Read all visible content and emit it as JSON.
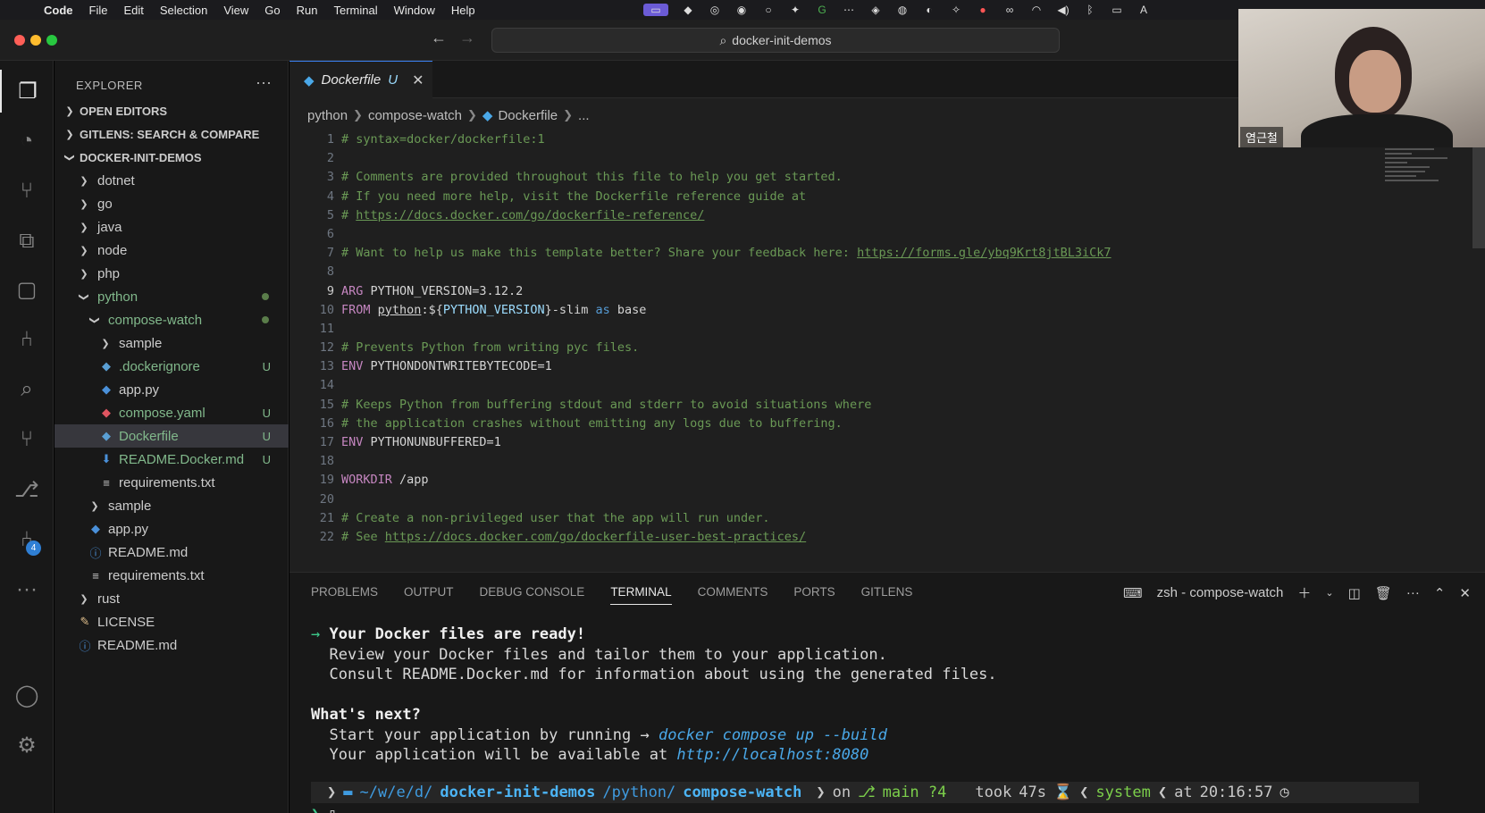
{
  "menubar": {
    "apple": "",
    "items": [
      "Code",
      "File",
      "Edit",
      "Selection",
      "View",
      "Go",
      "Run",
      "Terminal",
      "Window",
      "Help"
    ]
  },
  "titlebar": {
    "search": "docker-init-demos"
  },
  "sidebar": {
    "title": "EXPLORER",
    "more": "···",
    "sections": [
      "OPEN EDITORS",
      "GITLENS: SEARCH & COMPARE",
      "DOCKER-INIT-DEMOS"
    ],
    "tree": [
      {
        "label": "dotnet",
        "depth": 1,
        "kind": "folder",
        "open": false,
        "status": ""
      },
      {
        "label": "go",
        "depth": 1,
        "kind": "folder",
        "open": false,
        "status": ""
      },
      {
        "label": "java",
        "depth": 1,
        "kind": "folder",
        "open": false,
        "status": ""
      },
      {
        "label": "node",
        "depth": 1,
        "kind": "folder",
        "open": false,
        "status": ""
      },
      {
        "label": "php",
        "depth": 1,
        "kind": "folder",
        "open": false,
        "status": ""
      },
      {
        "label": "python",
        "depth": 1,
        "kind": "folder",
        "open": true,
        "status": "dot"
      },
      {
        "label": "compose-watch",
        "depth": 2,
        "kind": "folder",
        "open": true,
        "status": "dot"
      },
      {
        "label": "sample",
        "depth": 3,
        "kind": "folder",
        "open": false,
        "status": ""
      },
      {
        "label": ".dockerignore",
        "depth": 3,
        "kind": "docker",
        "status": "U"
      },
      {
        "label": "app.py",
        "depth": 3,
        "kind": "py",
        "status": ""
      },
      {
        "label": "compose.yaml",
        "depth": 3,
        "kind": "yaml",
        "status": "U"
      },
      {
        "label": "Dockerfile",
        "depth": 3,
        "kind": "docker",
        "status": "U",
        "selected": true
      },
      {
        "label": "README.Docker.md",
        "depth": 3,
        "kind": "md",
        "status": "U"
      },
      {
        "label": "requirements.txt",
        "depth": 3,
        "kind": "txt",
        "status": ""
      },
      {
        "label": "sample",
        "depth": 2,
        "kind": "folder",
        "open": false,
        "status": ""
      },
      {
        "label": "app.py",
        "depth": 2,
        "kind": "py",
        "status": ""
      },
      {
        "label": "README.md",
        "depth": 2,
        "kind": "info",
        "status": ""
      },
      {
        "label": "requirements.txt",
        "depth": 2,
        "kind": "txt",
        "status": ""
      },
      {
        "label": "rust",
        "depth": 1,
        "kind": "folder",
        "open": false,
        "status": ""
      },
      {
        "label": "LICENSE",
        "depth": 1,
        "kind": "license",
        "status": ""
      },
      {
        "label": "README.md",
        "depth": 1,
        "kind": "info",
        "status": ""
      }
    ]
  },
  "activity": {
    "source_control_badge": "4"
  },
  "editor": {
    "tab": {
      "label": "Dockerfile",
      "modified": "U",
      "close": "✕"
    },
    "breadcrumbs": [
      "python",
      "compose-watch",
      "Dockerfile",
      "..."
    ],
    "lines": [
      {
        "n": "1",
        "segs": [
          [
            "c-com",
            "# syntax=docker/dockerfile:1"
          ]
        ]
      },
      {
        "n": "2",
        "segs": []
      },
      {
        "n": "3",
        "segs": [
          [
            "c-com",
            "# Comments are provided throughout this file to help you get started."
          ]
        ]
      },
      {
        "n": "4",
        "segs": [
          [
            "c-com",
            "# If you need more help, visit the Dockerfile reference guide at"
          ]
        ]
      },
      {
        "n": "5",
        "segs": [
          [
            "c-com",
            "# "
          ],
          [
            "c-link",
            "https://docs.docker.com/go/dockerfile-reference/"
          ]
        ]
      },
      {
        "n": "6",
        "segs": []
      },
      {
        "n": "7",
        "segs": [
          [
            "c-com",
            "# Want to help us make this template better? Share your feedback here: "
          ],
          [
            "c-link",
            "https://forms.gle/ybq9Krt8jtBL3iCk7"
          ]
        ]
      },
      {
        "n": "8",
        "segs": []
      },
      {
        "n": "9",
        "segs": [
          [
            "c-kw",
            "ARG"
          ],
          [
            "c-txt",
            " PYTHON_VERSION=3.12.2"
          ]
        ],
        "current": true
      },
      {
        "n": "10",
        "segs": [
          [
            "c-kw",
            "FROM"
          ],
          [
            "c-txt",
            " "
          ],
          [
            "c-link-plain",
            "python"
          ],
          [
            "c-txt",
            ":${"
          ],
          [
            "c-blue",
            "PYTHON_VERSION"
          ],
          [
            "c-txt",
            "}-slim "
          ],
          [
            "c-as",
            "as"
          ],
          [
            "c-txt",
            " base"
          ]
        ]
      },
      {
        "n": "11",
        "segs": []
      },
      {
        "n": "12",
        "segs": [
          [
            "c-com",
            "# Prevents Python from writing pyc files."
          ]
        ]
      },
      {
        "n": "13",
        "segs": [
          [
            "c-kw",
            "ENV"
          ],
          [
            "c-txt",
            " PYTHONDONTWRITEBYTECODE=1"
          ]
        ]
      },
      {
        "n": "14",
        "segs": []
      },
      {
        "n": "15",
        "segs": [
          [
            "c-com",
            "# Keeps Python from buffering stdout and stderr to avoid situations where"
          ]
        ]
      },
      {
        "n": "16",
        "segs": [
          [
            "c-com",
            "# the application crashes without emitting any logs due to buffering."
          ]
        ]
      },
      {
        "n": "17",
        "segs": [
          [
            "c-kw",
            "ENV"
          ],
          [
            "c-txt",
            " PYTHONUNBUFFERED=1"
          ]
        ]
      },
      {
        "n": "18",
        "segs": []
      },
      {
        "n": "19",
        "segs": [
          [
            "c-kw",
            "WORKDIR"
          ],
          [
            "c-txt",
            " /app"
          ]
        ]
      },
      {
        "n": "20",
        "segs": []
      },
      {
        "n": "21",
        "segs": [
          [
            "c-com",
            "# Create a non-privileged user that the app will run under."
          ]
        ]
      },
      {
        "n": "22",
        "segs": [
          [
            "c-com",
            "# See "
          ],
          [
            "c-link",
            "https://docs.docker.com/go/dockerfile-user-best-practices/"
          ]
        ]
      }
    ]
  },
  "panel": {
    "tabs": [
      "PROBLEMS",
      "OUTPUT",
      "DEBUG CONSOLE",
      "TERMINAL",
      "COMMENTS",
      "PORTS",
      "GITLENS"
    ],
    "active_tab": "TERMINAL",
    "terminal_name": "zsh - compose-watch",
    "terminal": {
      "ready_arrow": "→",
      "ready": "Your Docker files are ready!",
      "review": "Review your Docker files and tailor them to your application.",
      "consult": "Consult README.Docker.md for information about using the generated files.",
      "next": "What's next?",
      "start_prefix": "Start your application by running → ",
      "start_cmd": "docker compose up --build",
      "avail_prefix": "Your application will be available at ",
      "avail_url": "http://localhost:8080"
    },
    "prompt": {
      "path_prefix": "~/w/e/d/",
      "repo": "docker-init-demos",
      "slash1": "/python/",
      "leaf": "compose-watch",
      "on": "on",
      "branch": "main ?4",
      "took_label": "took",
      "took": "47s",
      "env": "system",
      "at": "at",
      "time": "20:16:57"
    }
  },
  "webcam": {
    "name": "염근철"
  }
}
